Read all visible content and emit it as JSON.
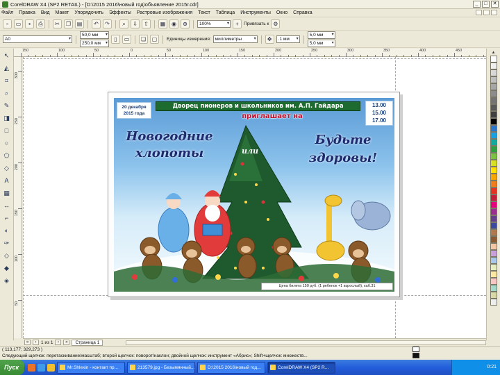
{
  "window": {
    "title": "CorelDRAW X4 (SP2 RETAIL) - [D:\\2015 2016\\новый год\\объявление 2015г.cdr]",
    "controls": [
      "_",
      "□",
      "✕"
    ]
  },
  "menu": [
    "Файл",
    "Правка",
    "Вид",
    "Макет",
    "Упорядочить",
    "Эффекты",
    "Растровые изображения",
    "Текст",
    "Таблица",
    "Инструменты",
    "Окно",
    "Справка"
  ],
  "toolbar1": {
    "zoom": "100%",
    "snap_label": "Привязать к"
  },
  "toolbar2": {
    "paper_size": "A0",
    "width": "50,0 мм",
    "height": "250,0 мм",
    "units_label": "Единицы измерения:",
    "units": "миллиметры",
    "nudge": ".1 мм",
    "dup_x": "5,0 мм",
    "dup_y": "5,0 мм"
  },
  "rulers": {
    "h_labels": [
      "150",
      "100",
      "50",
      "0",
      "50",
      "100",
      "150",
      "200",
      "250",
      "300",
      "350",
      "400",
      "450"
    ],
    "v_labels": [
      "300",
      "250",
      "200",
      "150",
      "100",
      "50"
    ],
    "h_unit": "миллиметры"
  },
  "poster": {
    "date": "20 декабря\n2015 года",
    "banner": "Дворец пионеров и школьников  им. А.П. Гайдара",
    "invites": "приглашает на",
    "times": [
      "13.00",
      "15.00",
      "17.00"
    ],
    "left_title_1": "Новогодние",
    "left_title_2": "хлопоты",
    "or_word": "или",
    "right_title_1": "Будьте",
    "right_title_2": "здоровы!",
    "price": "Цена билета 150 руб. (1 ребенок +1 взрослый), каб.31"
  },
  "pagenav": {
    "counter": "1 из 1",
    "tab": "Страница 1"
  },
  "status": {
    "coords": "( 113,177; 329,273 )",
    "hint": "Следующий щелчок: перетаскивание/масштаб; второй щелчок: поворот/наклон; двойной щелчок: инструмент «Абрис»; Shift+щелчок: множеств..."
  },
  "taskbar": {
    "start": "Пуск",
    "tasks": [
      "Mr.Shlexin - контакт пр...",
      "213579.jpg - Безымянный...",
      "D:\\2015 2016\\новый год...",
      "CorelDRAW X4 (SP2 R..."
    ],
    "clock": "0:21"
  },
  "palette_colors": [
    "#ffffff",
    "#f0f0f0",
    "#d8d8d8",
    "#bfbfbf",
    "#a6a6a6",
    "#8c8c8c",
    "#737373",
    "#595959",
    "#404040",
    "#000000",
    "#2b76c6",
    "#1aa0e0",
    "#13a89e",
    "#2e9e3e",
    "#7cc242",
    "#d7e022",
    "#ffe100",
    "#f7a600",
    "#ef7d1a",
    "#e53222",
    "#c21f3a",
    "#e6007e",
    "#9b2d8f",
    "#633f8c",
    "#3c4a9e",
    "#b07a4f",
    "#8a5a33",
    "#f3c7a6",
    "#c9a0dc",
    "#a7c8e8",
    "#e4ecc1",
    "#fce8a1",
    "#f9c6c6",
    "#a3d9c9",
    "#d9d9a7",
    "#eeeeee"
  ],
  "icons": {
    "tools": [
      "pick-icon",
      "shape-icon",
      "crop-icon",
      "zoom-icon",
      "freehand-icon",
      "smart-fill-icon",
      "rectangle-icon",
      "ellipse-icon",
      "polygon-icon",
      "text-icon",
      "table-icon",
      "dimension-icon",
      "connector-icon",
      "blend-icon",
      "eyedropper-icon",
      "outline-icon",
      "fill-icon",
      "interactive-fill-icon"
    ]
  }
}
